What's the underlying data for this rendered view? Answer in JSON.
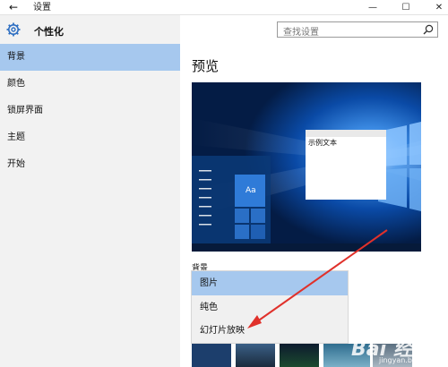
{
  "window": {
    "title": "设置",
    "back_glyph": "←",
    "min_glyph": "—",
    "max_glyph": "☐",
    "close_glyph": "✕"
  },
  "header": {
    "title": "个性化",
    "search_placeholder": "查找设置"
  },
  "sidebar": {
    "items": [
      {
        "label": "背景",
        "active": true
      },
      {
        "label": "颜色"
      },
      {
        "label": "锁屏界面"
      },
      {
        "label": "主题"
      },
      {
        "label": "开始"
      }
    ]
  },
  "main": {
    "preview_title": "预览",
    "preview": {
      "sample_text": "示例文本",
      "tile_text": "Aa"
    },
    "background_label": "背景",
    "dropdown_options": [
      "图片",
      "纯色",
      "幻灯片放映"
    ],
    "selected_option": "图片"
  },
  "watermark": {
    "text": "Bai 经验",
    "url": "jingyan.baidu.com"
  },
  "colors": {
    "accent": "#a6c8ee",
    "sidebar_bg": "#f2f2f2",
    "preview_bg": "#0a3f8c",
    "arrow": "#e0312b"
  }
}
